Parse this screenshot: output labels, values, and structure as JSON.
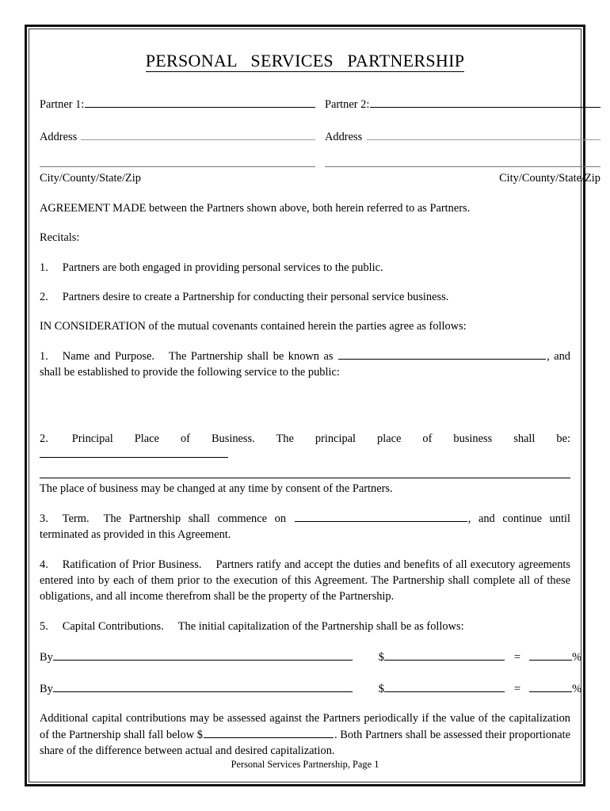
{
  "document": {
    "title": "PERSONAL   SERVICES   PARTNERSHIP",
    "footer": "Personal Services Partnership, Page 1"
  },
  "parties": {
    "partner1_label": "Partner 1:",
    "partner2_label": "Partner 2:",
    "address1_label": "Address",
    "address2_label": "Address",
    "citystate1_label": "City/County/State/Zip",
    "citystate2_label": "City/County/State/Zip"
  },
  "body": {
    "agreement": "AGREEMENT   MADE between the Partners shown above, both herein referred to as Partners.",
    "recitals_heading": "Recitals:",
    "recital_1_num": "1.",
    "recital_1": "Partners are both engaged in providing personal services to the public.",
    "recital_2_num": "2.",
    "recital_2": "Partners desire to create a Partnership for conducting their personal service business.",
    "consideration": "IN CONSIDERATION of the mutual covenants contained herein the parties agree as follows:"
  },
  "clauses": {
    "c1_num": "1.",
    "c1_title": "Name and Purpose.",
    "c1_text_before": "The   Partnership shall be known as",
    "c1_text_after": ", and shall be established to provide the following service to the public:",
    "c2_num": "2.",
    "c2_text": "Principal Place of Business.   The principal place of business shall be:",
    "c2_note": "The place of business may be changed at any time by consent of the Partners.",
    "c3_num": "3.",
    "c3_title": "Term.",
    "c3_text_before": "The Partnership shall commence on",
    "c3_text_after": ", and continue until terminated as provided in this Agreement.",
    "c4_num": "4.",
    "c4_title": "Ratification of Prior Business.",
    "c4_text": "Partners ratify and accept the duties and benefits of all executory agreements entered into by each of them prior to the execution of this Agreement.   The Partnership shall complete all of these obligations, and all income therefrom shall be the property of the Partnership.",
    "c5_num": "5.",
    "c5_title": "Capital Contributions.",
    "c5_text": "The initial capitalization of the Partnership shall be as follows:"
  },
  "capital_rows": [
    {
      "by_label": "By",
      "currency": "$",
      "equals": "=",
      "percent": "%"
    },
    {
      "by_label": "By",
      "currency": "$",
      "equals": "=",
      "percent": "%"
    }
  ],
  "additional": {
    "text_before": "Additional capital contributions may be assessed against the Partners periodically if the value of the capitalization of the Partnership shall fall below $",
    "text_after": ". Both Partners shall be assessed their proportionate share of the difference between actual and desired capitalization."
  }
}
